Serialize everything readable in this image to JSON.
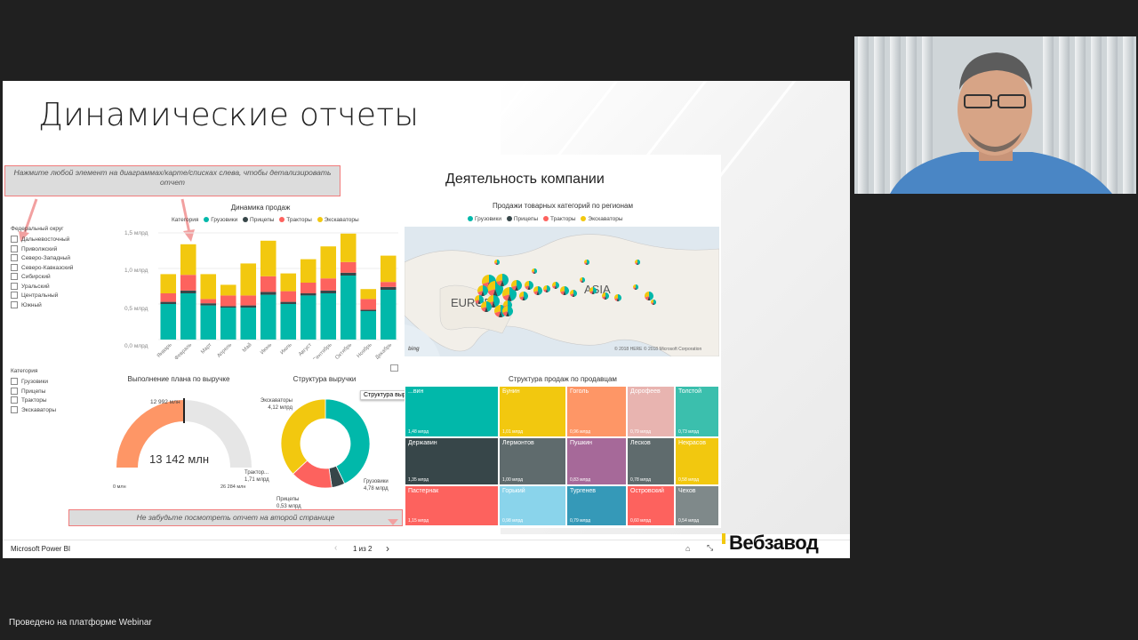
{
  "slide": {
    "title": "Динамические отчеты",
    "report_title": "Деятельность компании"
  },
  "hints": {
    "top": "Нажмите любой элемент на диаграммах/карте/списках слева, чтобы детализировать отчет",
    "bottom": "Не забудьте посмотреть отчет на второй странице"
  },
  "filters": {
    "region_title": "Федеральный округ",
    "regions": [
      "Дальневосточный",
      "Приволжский",
      "Северо-Западный",
      "Северо-Кавказский",
      "Сибирский",
      "Уральский",
      "Центральный",
      "Южный"
    ],
    "category_title": "Категория",
    "categories": [
      "Грузовики",
      "Прицепы",
      "Тракторы",
      "Экскаваторы"
    ]
  },
  "colors": {
    "trucks": "#01b8aa",
    "trailers": "#374649",
    "tractors": "#fd625e",
    "excavators": "#f2c80f",
    "webcam_shirt": "#4a86c5"
  },
  "sales_chart": {
    "title": "Динамика продаж",
    "legend_title": "Категория",
    "legend": [
      "Грузовики",
      "Прицепы",
      "Тракторы",
      "Экскаваторы"
    ],
    "y_ticks": [
      "1,5 млрд",
      "1,0 млрд",
      "0,5 млрд",
      "0,0 млрд"
    ]
  },
  "chart_data": {
    "type": "bar",
    "stacked": true,
    "categories": [
      "Январь",
      "Февраль",
      "Март",
      "Апрель",
      "Май",
      "Июнь",
      "Июль",
      "Август",
      "Сентябрь",
      "Октябрь",
      "Ноябрь",
      "Декабрь"
    ],
    "series": [
      {
        "name": "Грузовики",
        "values": [
          0.5,
          0.65,
          0.48,
          0.45,
          0.45,
          0.63,
          0.5,
          0.62,
          0.65,
          0.9,
          0.4,
          0.7
        ]
      },
      {
        "name": "Прицепы",
        "values": [
          0.03,
          0.04,
          0.03,
          0.02,
          0.03,
          0.04,
          0.03,
          0.03,
          0.04,
          0.04,
          0.02,
          0.04
        ]
      },
      {
        "name": "Тракторы",
        "values": [
          0.12,
          0.22,
          0.06,
          0.15,
          0.14,
          0.22,
          0.15,
          0.15,
          0.17,
          0.15,
          0.15,
          0.07
        ]
      },
      {
        "name": "Экскаваторы",
        "values": [
          0.27,
          0.43,
          0.35,
          0.15,
          0.45,
          0.5,
          0.25,
          0.33,
          0.45,
          0.4,
          0.14,
          0.37
        ]
      }
    ],
    "ylim": [
      0,
      1.5
    ]
  },
  "map_chart": {
    "title": "Продажи товарных категорий по регионам",
    "legend": [
      "Грузовики",
      "Прицепы",
      "Тракторы",
      "Экскаваторы"
    ],
    "labels": [
      "EUROPE",
      "ASIA"
    ],
    "credit": "© 2018 HERE  © 2018 Microsoft Corporation",
    "bing": "bing"
  },
  "gauge": {
    "title": "Выполнение плана по выручке",
    "value_label": "13 142 млн",
    "target_label": "12 992 млн",
    "min_label": "0 млн",
    "max_label": "26 284 млн",
    "fill_fraction": 0.5
  },
  "donut": {
    "title": "Структура выручки",
    "tooltip": "Структура выручки",
    "labels": [
      {
        "name": "Экскаваторы",
        "value": "4,12 млрд"
      },
      {
        "name": "Трактор...",
        "value": "1,71 млрд"
      },
      {
        "name": "Прицепы",
        "value": "0,53 млрд"
      },
      {
        "name": "Грузовики",
        "value": "4,78 млрд"
      }
    ],
    "values": [
      4.78,
      0.53,
      1.71,
      4.12
    ]
  },
  "treemap": {
    "title": "Структура продаж по продавцам",
    "cells": [
      {
        "name": "...вин",
        "value": "1,48 млрд",
        "color": "#01b8aa"
      },
      {
        "name": "Бунин",
        "value": "1,01 млрд",
        "color": "#f2c80f"
      },
      {
        "name": "Гоголь",
        "value": "0,96 млрд",
        "color": "#fe9666"
      },
      {
        "name": "Дорофеев",
        "value": "0,79 млрд",
        "color": "#e8b4b0"
      },
      {
        "name": "Толстой",
        "value": "0,73 млрд",
        "color": "#3bbfad"
      },
      {
        "name": "Державин",
        "value": "1,35 млрд",
        "color": "#374649"
      },
      {
        "name": "Лермонтов",
        "value": "1,00 млрд",
        "color": "#5f6b6d"
      },
      {
        "name": "Пушкин",
        "value": "0,83 млрд",
        "color": "#a66999"
      },
      {
        "name": "Лесков",
        "value": "0,78 млрд",
        "color": "#5f6b6d"
      },
      {
        "name": "Некрасов",
        "value": "0,58 млрд",
        "color": "#f2c80f"
      },
      {
        "name": "Пастернак",
        "value": "1,15 млрд",
        "color": "#fd625e"
      },
      {
        "name": "Горький",
        "value": "0,98 млрд",
        "color": "#8ad4eb"
      },
      {
        "name": "Тургенев",
        "value": "0,79 млрд",
        "color": "#3599b8"
      },
      {
        "name": "Островский",
        "value": "0,60 млрд",
        "color": "#fd625e"
      },
      {
        "name": "Чехов",
        "value": "0,54 млрд",
        "color": "#7f898a"
      }
    ]
  },
  "statusbar": {
    "app_name": "Microsoft Power BI",
    "page_indicator": "1 из 2"
  },
  "brand": "Вебзавод",
  "footer": "Проведено на платформе Webinar"
}
